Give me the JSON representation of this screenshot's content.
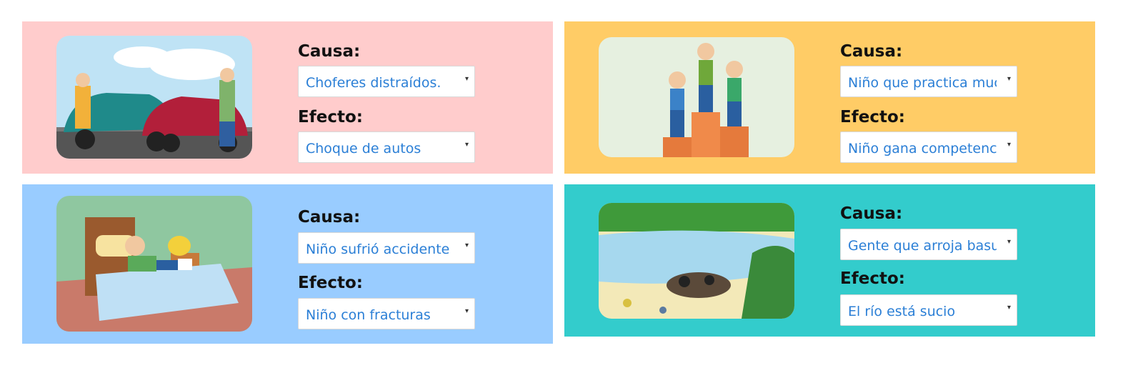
{
  "cards": [
    {
      "color": "#ffcccc",
      "image_icon": "car-crash-illustration",
      "cause_label": "Causa:",
      "cause_value": "Choferes distraídos.",
      "effect_label": "Efecto:",
      "effect_value": "Choque de autos"
    },
    {
      "color": "#ffcc66",
      "image_icon": "podium-winners-illustration",
      "cause_label": "Causa:",
      "cause_value": "Niño que practica mucho",
      "effect_label": "Efecto:",
      "effect_value": "Niño gana competencia"
    },
    {
      "color": "#99ccff",
      "image_icon": "injured-child-bed-illustration",
      "cause_label": "Causa:",
      "cause_value": "Niño sufrió accidente",
      "effect_label": "Efecto:",
      "effect_value": "Niño con fracturas"
    },
    {
      "color": "#33cccc",
      "image_icon": "polluted-river-illustration",
      "cause_label": "Causa:",
      "cause_value": "Gente que arroja basura",
      "effect_label": "Efecto:",
      "effect_value": "El río está sucio"
    }
  ],
  "dropdown_caret": "▾"
}
